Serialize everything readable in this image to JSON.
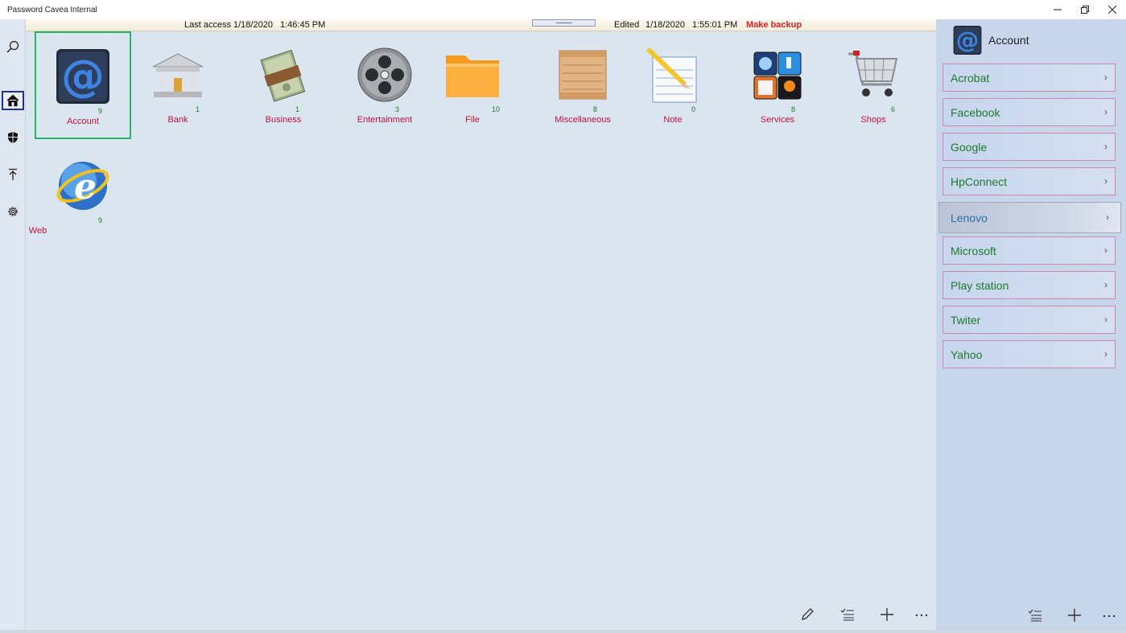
{
  "window": {
    "title": "Password Cavea Internal",
    "controls": [
      "minimize-icon",
      "restore-icon",
      "close-icon"
    ]
  },
  "rail": {
    "items": [
      {
        "name": "search-icon"
      },
      {
        "name": "home-icon",
        "selected": true
      },
      {
        "name": "shield-icon"
      },
      {
        "name": "upload-icon"
      },
      {
        "name": "gear-icon"
      }
    ]
  },
  "info": {
    "last_access_label": "Last access",
    "last_access_date": "1/18/2020",
    "last_access_time": "1:46:45 PM",
    "edited_label": "Edited",
    "edited_date": "1/18/2020",
    "edited_time": "1:55:01 PM",
    "backup_label": "Make backup"
  },
  "categories": [
    {
      "label": "Account",
      "count": "9",
      "icon": "at-sign-icon",
      "selected": true
    },
    {
      "label": "Bank",
      "count": "1",
      "icon": "bank-icon"
    },
    {
      "label": "Business",
      "count": "1",
      "icon": "money-stack-icon"
    },
    {
      "label": "Entertainment",
      "count": "3",
      "icon": "film-reel-icon"
    },
    {
      "label": "File",
      "count": "10",
      "icon": "folder-icon"
    },
    {
      "label": "Miscellaneous",
      "count": "8",
      "icon": "crate-icon"
    },
    {
      "label": "Note",
      "count": "0",
      "icon": "notepad-icon"
    },
    {
      "label": "Services",
      "count": "8",
      "icon": "services-icon"
    },
    {
      "label": "Shops",
      "count": "6",
      "icon": "shopping-cart-icon"
    },
    {
      "label": "Web",
      "count": "9",
      "icon": "globe-ie-icon"
    }
  ],
  "main_commands": [
    "edit-icon",
    "checklist-icon",
    "add-icon",
    "more-icon"
  ],
  "panel": {
    "title": "Account",
    "items": [
      "Acrobat",
      "Facebook",
      "Google",
      "HpConnect",
      "Lenovo",
      "Microsoft",
      "Play station",
      "Twiter",
      "Yahoo"
    ],
    "hover_index": 4,
    "commands": [
      "checklist-icon",
      "add-icon",
      "more-icon"
    ]
  },
  "colors": {
    "label": "#c0143c",
    "count": "#1a7a20",
    "selection": "#27b46a",
    "backup": "#e02020"
  }
}
